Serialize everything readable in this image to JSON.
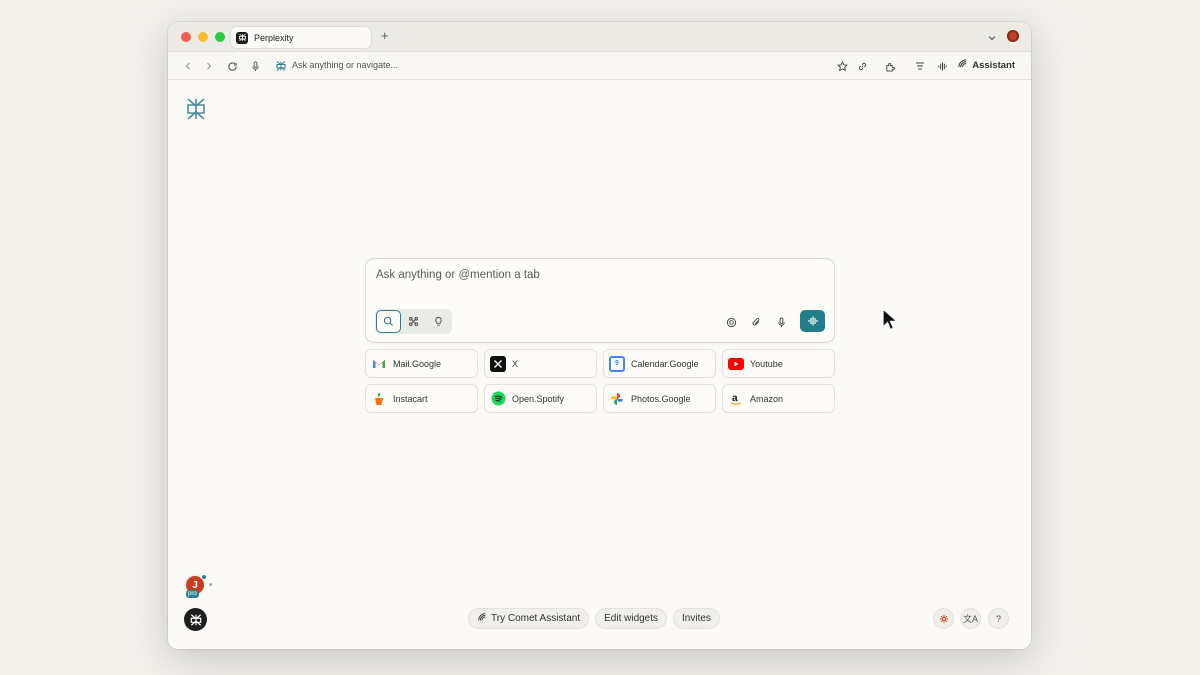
{
  "browser": {
    "tab_title": "Perplexity",
    "new_tab_glyph": "+",
    "omnibox_placeholder": "Ask anything or navigate...",
    "assistant_label": "Assistant"
  },
  "search": {
    "placeholder": "Ask anything or @mention a tab"
  },
  "shortcuts": [
    {
      "label": "Mail.Google",
      "icon": "gmail-icon"
    },
    {
      "label": "X",
      "icon": "x-icon"
    },
    {
      "label": "Calendar.Google",
      "icon": "google-calendar-icon"
    },
    {
      "label": "Youtube",
      "icon": "youtube-icon"
    },
    {
      "label": "Instacart",
      "icon": "instacart-icon"
    },
    {
      "label": "Open.Spotify",
      "icon": "spotify-icon"
    },
    {
      "label": "Photos.Google",
      "icon": "google-photos-icon"
    },
    {
      "label": "Amazon",
      "icon": "amazon-icon"
    }
  ],
  "footer": {
    "try_assistant": "Try Comet Assistant",
    "edit_widgets": "Edit widgets",
    "invites": "Invites",
    "help_glyph": "?",
    "translate_glyph": "文A"
  },
  "user": {
    "avatar_initial": "J",
    "badge": "pro"
  },
  "colors": {
    "accent": "#217e8a",
    "background": "#fbfaf6"
  }
}
